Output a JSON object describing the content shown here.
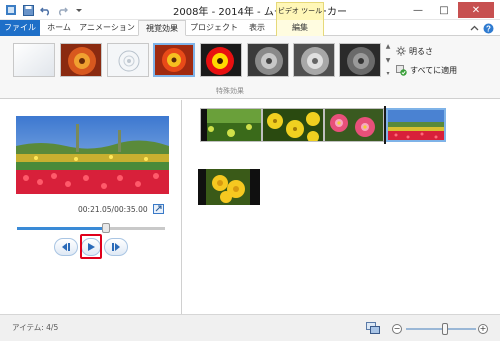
{
  "window": {
    "title": "2008年 - 2014年 - ムービー メーカー",
    "context_tab_group": "ビデオ ツール",
    "buttons": {
      "minimize": "—",
      "maximize": "□",
      "close": "✕"
    }
  },
  "ribbon": {
    "tabs": [
      {
        "label": "ファイル"
      },
      {
        "label": "ホーム"
      },
      {
        "label": "アニメーション"
      },
      {
        "label": "視覚効果"
      },
      {
        "label": "プロジェクト"
      },
      {
        "label": "表示"
      },
      {
        "label": "編集"
      }
    ],
    "active_tab": "視覚効果",
    "group_label": "特殊効果",
    "commands": {
      "brightness": "明るさ",
      "apply_all": "すべてに適用"
    }
  },
  "preview": {
    "timecode": "00:21.05/00:35.00",
    "progress": 0.6
  },
  "status": {
    "items_text": "アイテム: 4/5",
    "zoom_level": 0.55
  },
  "colors": {
    "accent": "#1e6fc8",
    "highlight_red": "#e0001b",
    "context_tab": "#fff7b8",
    "selection": "#7fb3e8"
  }
}
